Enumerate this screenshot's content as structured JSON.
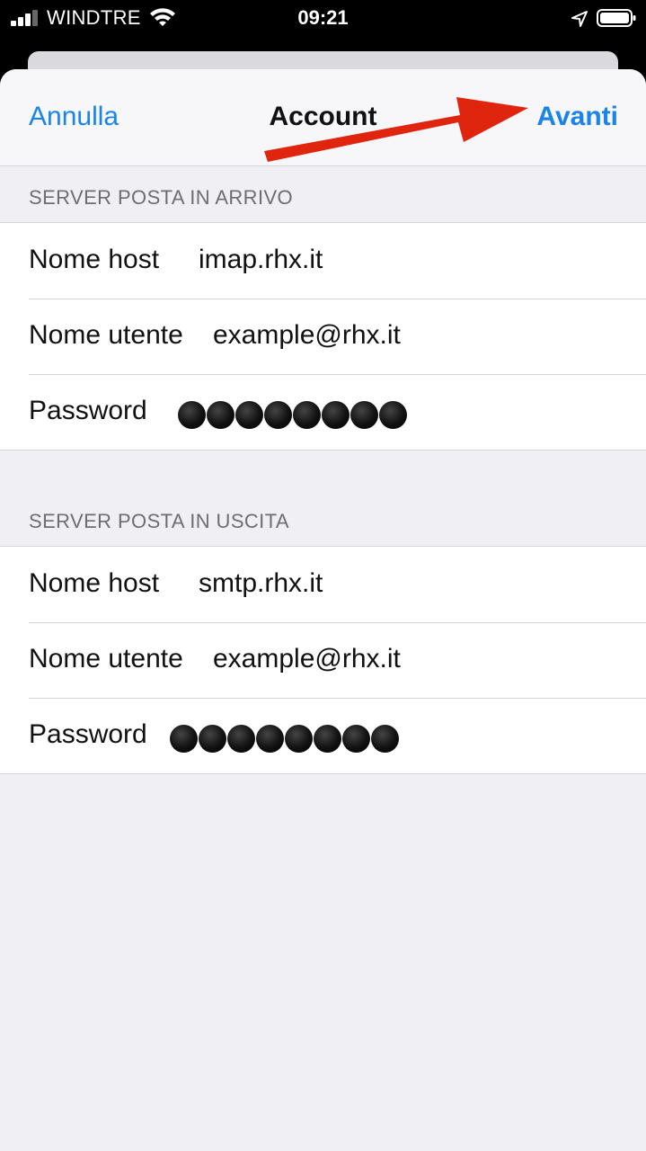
{
  "status_bar": {
    "carrier": "WINDTRE",
    "time": "09:21"
  },
  "nav": {
    "cancel_label": "Annulla",
    "title": "Account",
    "next_label": "Avanti",
    "accent_color": "#1a84ea"
  },
  "incoming": {
    "header": "SERVER POSTA IN ARRIVO",
    "host_label": "Nome host",
    "host_value": "imap.rhx.it",
    "user_label": "Nome utente",
    "user_value": "example@rhx.it",
    "password_label": "Password",
    "password_mask_length": 8
  },
  "outgoing": {
    "header": "SERVER POSTA IN USCITA",
    "host_label": "Nome host",
    "host_value": "smtp.rhx.it",
    "user_label": "Nome utente",
    "user_value": "example@rhx.it",
    "password_label": "Password",
    "password_mask_length": 8
  },
  "annotation": {
    "icon": "red-arrow-icon",
    "color": "#e0250f"
  }
}
